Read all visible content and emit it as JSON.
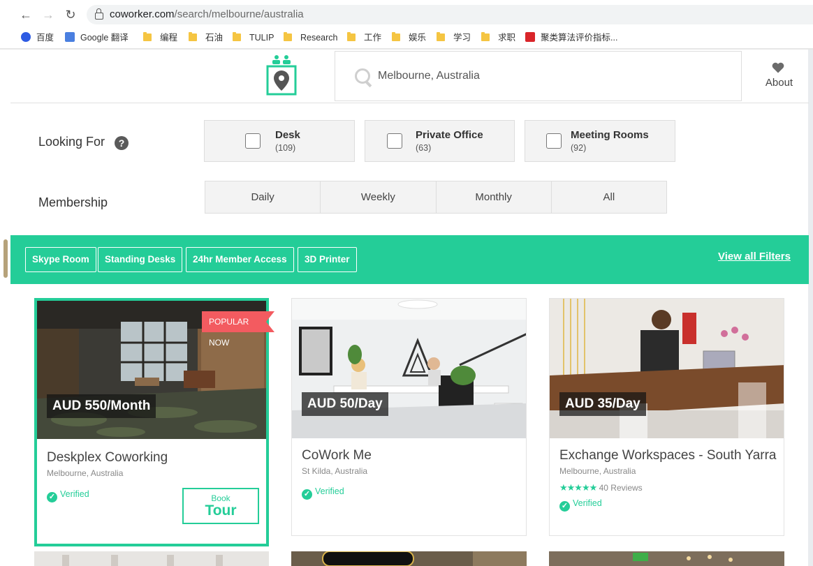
{
  "browser": {
    "url_host": "coworker.com",
    "url_path": "/search/melbourne/australia",
    "bookmarks": [
      "百度",
      "Google 翻译",
      "编程",
      "石油",
      "TULIP",
      "Research",
      "工作",
      "娱乐",
      "学习",
      "求职",
      "聚类算法评价指标..."
    ]
  },
  "header": {
    "search_value": "Melbourne, Australia",
    "about_label": "About"
  },
  "filters": {
    "looking_for_label": "Looking For",
    "help_symbol": "?",
    "options": [
      {
        "title": "Desk",
        "count": "(109)"
      },
      {
        "title": "Private Office",
        "count": "(63)"
      },
      {
        "title": "Meeting Rooms",
        "count": "(92)"
      }
    ],
    "membership_label": "Membership",
    "membership_options": [
      "Daily",
      "Weekly",
      "Monthly",
      "All"
    ]
  },
  "amenities": {
    "tags": [
      "Skype Room",
      "Standing Desks",
      "24hr Member Access",
      "3D Printer"
    ],
    "view_all": "View all Filters"
  },
  "cards": [
    {
      "price": "AUD 550/Month",
      "title": "Deskplex Coworking",
      "location": "Melbourne, Australia",
      "verified": "Verified",
      "badge": "POPULAR NOW",
      "tour_small": "Book",
      "tour_big": "Tour"
    },
    {
      "price": "AUD 50/Day",
      "title": "CoWork Me",
      "location": "St Kilda, Australia",
      "verified": "Verified"
    },
    {
      "price": "AUD 35/Day",
      "title": "Exchange Workspaces - South Yarra",
      "location": "Melbourne, Australia",
      "reviews": "40 Reviews",
      "rating": 5,
      "verified": "Verified"
    }
  ],
  "colors": {
    "accent": "#24cd98",
    "badge": "#f35b60"
  }
}
